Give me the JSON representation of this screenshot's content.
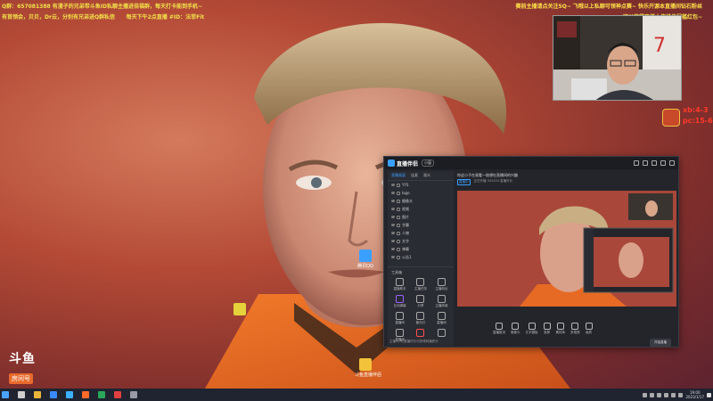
{
  "overlay": {
    "left_line1": "Q群：657081388 有漫子的兄弟带斗鱼ID私聊主播进倍福群，每天打卡能到手机~",
    "left_line2": "有首领会，贝贝，Dr云，分别有兄弟进Q群私信",
    "left_line3": "每天下午2点直播 #ID：法菲Fit",
    "right_line1": "赛前主播请点关注5Q~ 飞哦以上私聊可领神点赛~ 快乐开源本直播间钻石粉丝",
    "right_line2": "可以获得直播大佬排位门槛红包~"
  },
  "score": {
    "line1": "xb:4-3",
    "line2": "pc:15-6"
  },
  "desktop_icons": [
    {
      "label": "腾讯QQ"
    },
    {
      "label": ""
    },
    {
      "label": "斗鱼直播伴侣"
    }
  ],
  "douyu": {
    "brand": "斗鱼",
    "sub": "房间号",
    "room": "3302454"
  },
  "app": {
    "name": "直播伴侣",
    "version": "小窗",
    "left_tabs": [
      "直播画面",
      "连麦",
      "观众"
    ],
    "scenes": [
      "YYS",
      "logo",
      "摄像头",
      "视频",
      "图片",
      "字幕",
      "人物",
      "文字",
      "弹幕",
      "公告1"
    ],
    "tools_title": "工具箱",
    "tools": [
      "直播助手",
      "主播任务",
      "主播粉丝",
      "互动弹幕",
      "分享",
      "主播商城",
      "直播间",
      "聚光灯",
      "直播间",
      "直播间",
      "",
      ""
    ],
    "bottom_tip": "主播1小时直播时长可获得转播积分",
    "stream_title": "你这小子在观看一拨想在直播间的兴趣",
    "stream_meta_tag": "直播中",
    "stream_meta": "正在开播 302454 直播时长",
    "bottom_tools": [
      "直播推流",
      "摄像头",
      "文字模板",
      "录屏",
      "素材库",
      "多视频",
      "画质"
    ],
    "start_button": "开始直播"
  },
  "taskbar": {
    "time": "19:00",
    "date": "2023/1/17"
  }
}
